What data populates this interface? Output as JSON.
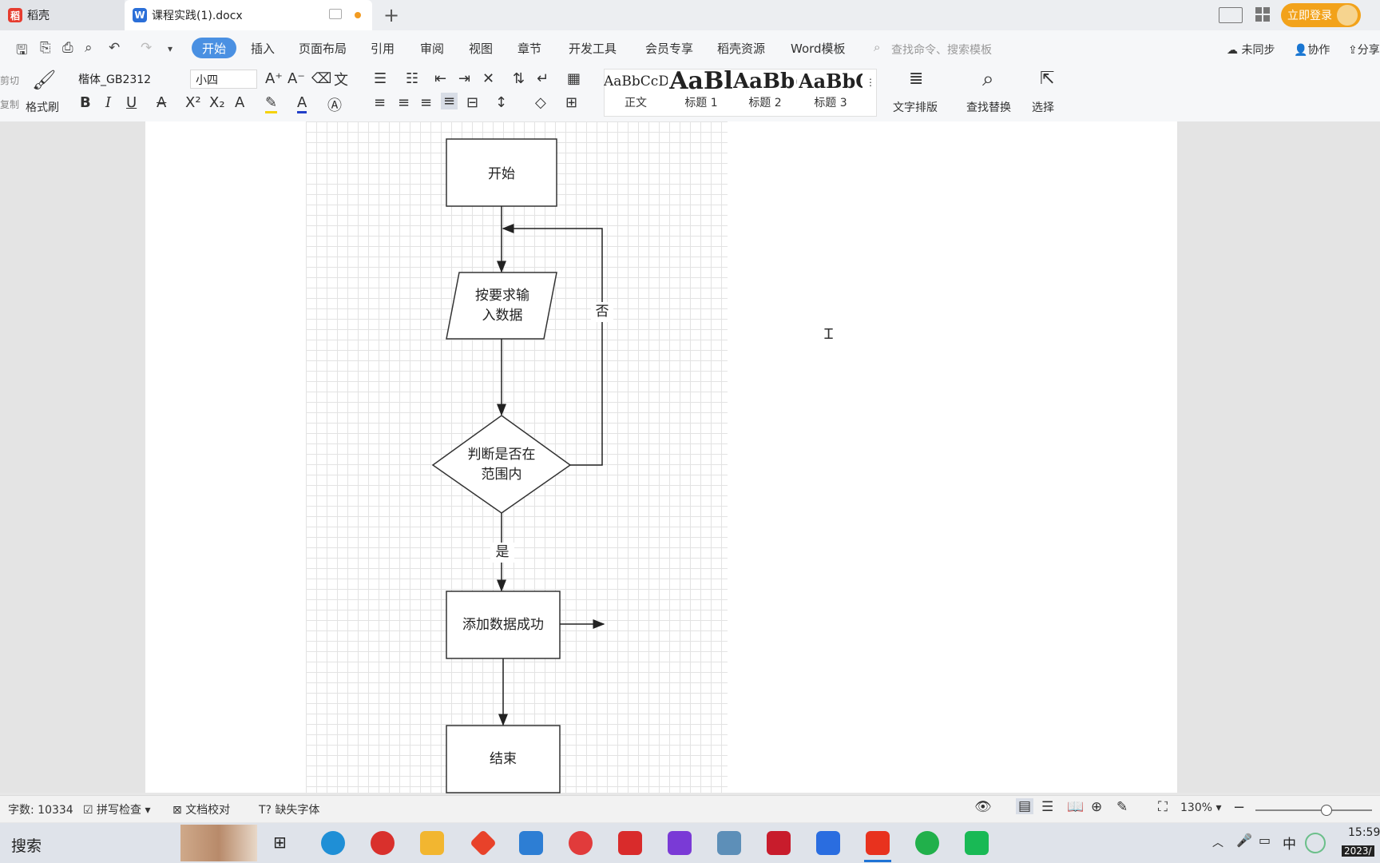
{
  "tabs": [
    {
      "label": "稻壳",
      "icon": "daoke-icon",
      "color": "#e63c2f"
    },
    {
      "label": "课程实践(1).docx",
      "icon": "wps-writer-icon",
      "color": "#2b6fd8"
    }
  ],
  "titlebar": {
    "login_label": "立即登录"
  },
  "menu": {
    "items": [
      "开始",
      "插入",
      "页面布局",
      "引用",
      "审阅",
      "视图",
      "章节",
      "开发工具",
      "会员专享",
      "稻壳资源",
      "Word模板"
    ],
    "search_placeholder": "查找命令、搜索模板",
    "sync_label": "未同步",
    "collab_label": "协作",
    "share_label": "分享"
  },
  "ribbon": {
    "cut_label": "剪切",
    "copy_label": "复制",
    "format_painter_label": "格式刷",
    "font_name": "楷体_GB2312",
    "font_size": "小四",
    "styles": [
      {
        "preview": "AaBbCcDd",
        "label": "正文"
      },
      {
        "preview": "AaBl",
        "label": "标题 1"
      },
      {
        "preview": "AaBb(",
        "label": "标题 2"
      },
      {
        "preview": "AaBbC",
        "label": "标题 3"
      }
    ],
    "text_layout_label": "文字排版",
    "find_replace_label": "查找替换",
    "select_label": "选择"
  },
  "flowchart": {
    "start": "开始",
    "input_line1": "按要求输",
    "input_line2": "入数据",
    "decision_line1": "判断是否在",
    "decision_line2": "范围内",
    "no_label": "否",
    "yes_label": "是",
    "success": "添加数据成功",
    "end": "结束"
  },
  "status": {
    "word_count": "字数: 10334",
    "spell_check": "拼写检查",
    "doc_proof": "文档校对",
    "missing_font": "缺失字体",
    "zoom": "130%"
  },
  "taskbar": {
    "search_label": "搜索",
    "ime": "中",
    "time": "15:59",
    "date": "2023/"
  },
  "colors": {
    "accent": "#4a90e2",
    "login": "#f2a21a"
  }
}
